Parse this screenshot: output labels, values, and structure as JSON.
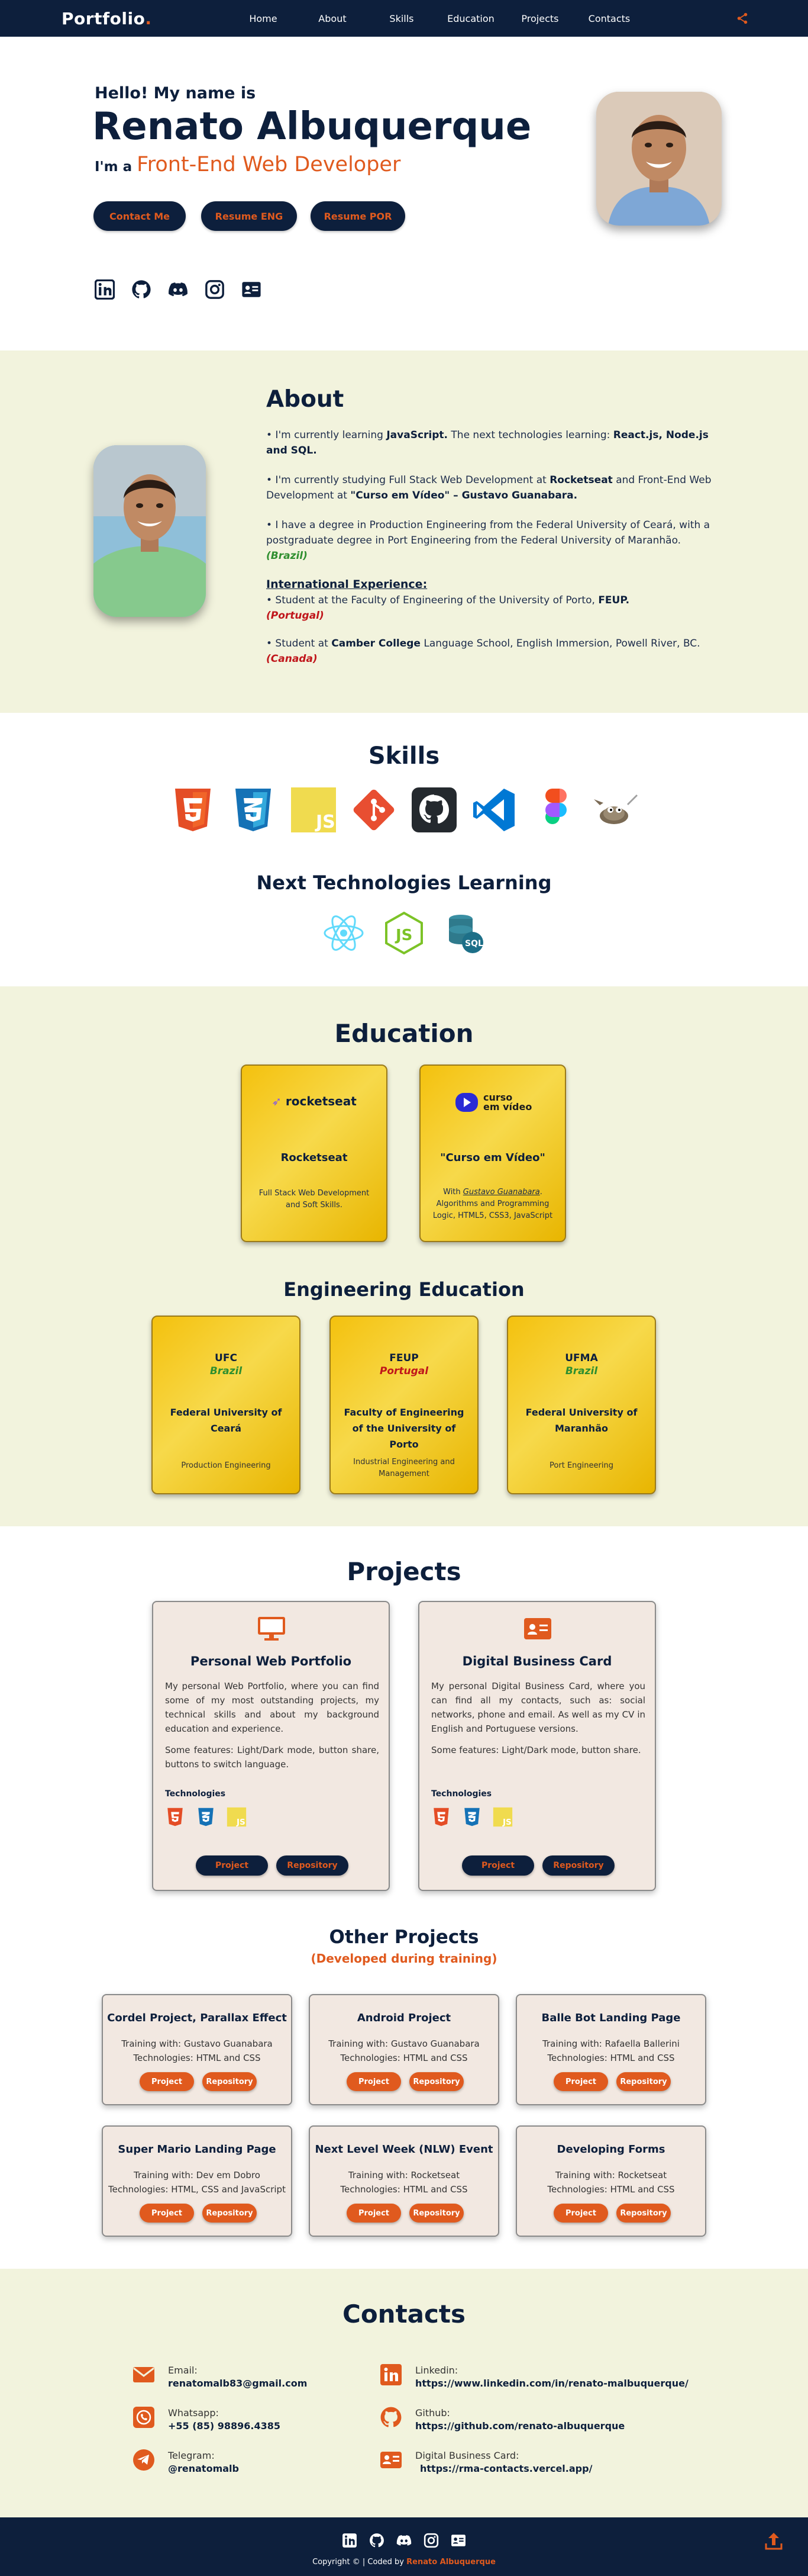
{
  "nav": {
    "logo": "Portfolio",
    "logo_dot": ".",
    "items": [
      "Home",
      "About",
      "Skills",
      "Education",
      "Projects",
      "Contacts"
    ],
    "share_icon": "share-icon"
  },
  "hero": {
    "hello": "Hello! My name is",
    "name": "Renato Albuquerque",
    "role_prefix": "I'm a ",
    "role": "Front-End Web Developer",
    "buttons": [
      "Contact Me",
      "Resume ENG",
      "Resume POR"
    ],
    "social_icons": [
      "linkedin-icon",
      "github-icon",
      "discord-icon",
      "instagram-icon",
      "contact-card-icon"
    ]
  },
  "about": {
    "title": "About",
    "p1_a": "• I'm currently learning ",
    "p1_b": "JavaScript.",
    "p1_c": " The next technologies learning: ",
    "p1_d": "React.js, Node.js and SQL.",
    "p2_a": "• I'm currently studying Full Stack Web Development at ",
    "p2_b": "Rocketseat",
    "p2_c": " and Front-End Web Development at ",
    "p2_d": "\"Curso em Vídeo\" – Gustavo Guanabara.",
    "p3": "• I have a degree in Production Engineering from the Federal University of Ceará, with a postgraduate degree in Port Engineering from the Federal University of Maranhão.",
    "p3_place": "(Brazil)",
    "intl_title": "International Experience:",
    "p4_a": "• Student at the Faculty of Engineering of the University of Porto, ",
    "p4_b": "FEUP.",
    "p4_place": "(Portugal)",
    "p5_a": "• Student at ",
    "p5_b": "Camber College",
    "p5_c": " Language School, English Immersion, Powell River, BC.",
    "p5_place": "(Canada)"
  },
  "skills": {
    "title": "Skills",
    "icons": [
      "html5-icon",
      "css3-icon",
      "javascript-icon",
      "git-icon",
      "github-icon",
      "vscode-icon",
      "figma-icon",
      "gimp-icon"
    ],
    "next_title": "Next Technologies Learning",
    "next_icons": [
      "react-icon",
      "nodejs-icon",
      "sql-icon"
    ]
  },
  "education": {
    "title": "Education",
    "courses": [
      {
        "logo": "rocketseat",
        "title": "Rocketseat",
        "desc": "Full Stack Web Development and Soft Skills."
      },
      {
        "logo_a": "curso",
        "logo_b": "em vídeo",
        "title": "\"Curso em Vídeo\"",
        "desc_a": "With ",
        "desc_link": "Gustavo Guanabara",
        "desc_b": ". Algorithms and Programming Logic, HTML5, CSS3, JavaScript"
      }
    ],
    "eng_title": "Engineering Education",
    "eng": [
      {
        "abbr": "UFC",
        "country": "Brazil",
        "name": "Federal University of Ceará",
        "course": "Production Engineering",
        "color": "#2f8f2f"
      },
      {
        "abbr": "FEUP",
        "country": "Portugal",
        "name": "Faculty of Engineering of the University of Porto",
        "course": "Industrial Engineering and Management",
        "color": "#c0161b"
      },
      {
        "abbr": "UFMA",
        "country": "Brazil",
        "name": "Federal University of Maranhão",
        "course": "Port Engineering",
        "color": "#2f8f2f"
      }
    ]
  },
  "projects": {
    "title": "Projects",
    "items": [
      {
        "icon": "monitor-icon",
        "title": "Personal Web Portfolio",
        "desc": "My personal Web Portfolio, where you can find some of my most outstanding projects, my technical skills and about my background education and experience.",
        "features": "Some features: Light/Dark mode, button share, buttons to switch language.",
        "tech_label": "Technologies",
        "btn1": "Project",
        "btn2": "Repository"
      },
      {
        "icon": "contact-card-icon",
        "title": "Digital Business Card",
        "desc": "My personal Digital Business Card, where you can find all my contacts, such as: social networks, phone and email. As well as my CV in English and Portuguese versions.",
        "features": "Some features: Light/Dark mode, button share.",
        "tech_label": "Technologies",
        "btn1": "Project",
        "btn2": "Repository"
      }
    ],
    "other_title": "Other Projects",
    "other_sub": "(Developed during training)",
    "other": [
      {
        "title": "Cordel Project, Parallax Effect",
        "l1": "Training with: Gustavo Guanabara",
        "l2": "Technologies: HTML and CSS",
        "btn1": "Project",
        "btn2": "Repository"
      },
      {
        "title": "Android Project",
        "l1": "Training with: Gustavo Guanabara",
        "l2": "Technologies: HTML and CSS",
        "btn1": "Project",
        "btn2": "Repository"
      },
      {
        "title": "Balle Bot Landing Page",
        "l1": "Training with: Rafaella Ballerini",
        "l2": "Technologies: HTML and CSS",
        "btn1": "Project",
        "btn2": "Repository"
      },
      {
        "title": "Super Mario Landing Page",
        "l1": "Training with: Dev em Dobro",
        "l2": "Technologies: HTML, CSS and JavaScript",
        "btn1": "Project",
        "btn2": "Repository"
      },
      {
        "title": "Next Level Week (NLW) Event",
        "l1": "Training with: Rocketseat",
        "l2": "Technologies: HTML and CSS",
        "btn1": "Project",
        "btn2": "Repository"
      },
      {
        "title": "Developing Forms",
        "l1": "Training with: Rocketseat",
        "l2": "Technologies: HTML and CSS",
        "btn1": "Project",
        "btn2": "Repository"
      }
    ]
  },
  "contacts": {
    "title": "Contacts",
    "left": [
      {
        "icon": "email-icon",
        "label": "Email:",
        "value": "renatomalb83@gmail.com"
      },
      {
        "icon": "whatsapp-icon",
        "label": "Whatsapp:",
        "value": "+55 (85) 98896.4385"
      },
      {
        "icon": "telegram-icon",
        "label": "Telegram:",
        "value": "@renatomalb"
      }
    ],
    "right": [
      {
        "icon": "linkedin-icon",
        "label": "Linkedin:",
        "value": "https://www.linkedin.com/in/renato-malbuquerque/"
      },
      {
        "icon": "github-icon",
        "label": "Github:",
        "value": "https://github.com/renato-albuquerque"
      },
      {
        "icon": "contact-card-icon",
        "label": "Digital Business Card:",
        "value": "https://rma-contacts.vercel.app/"
      }
    ]
  },
  "footer": {
    "copy_a": "Copyright © | Coded by ",
    "copy_b": "Renato Albuquerque",
    "up_icon": "upload-icon"
  },
  "colors": {
    "navy": "#0d1f3c",
    "orange": "#e05a1e",
    "cream": "#f2f3dd",
    "gold": "#f4c10e"
  }
}
